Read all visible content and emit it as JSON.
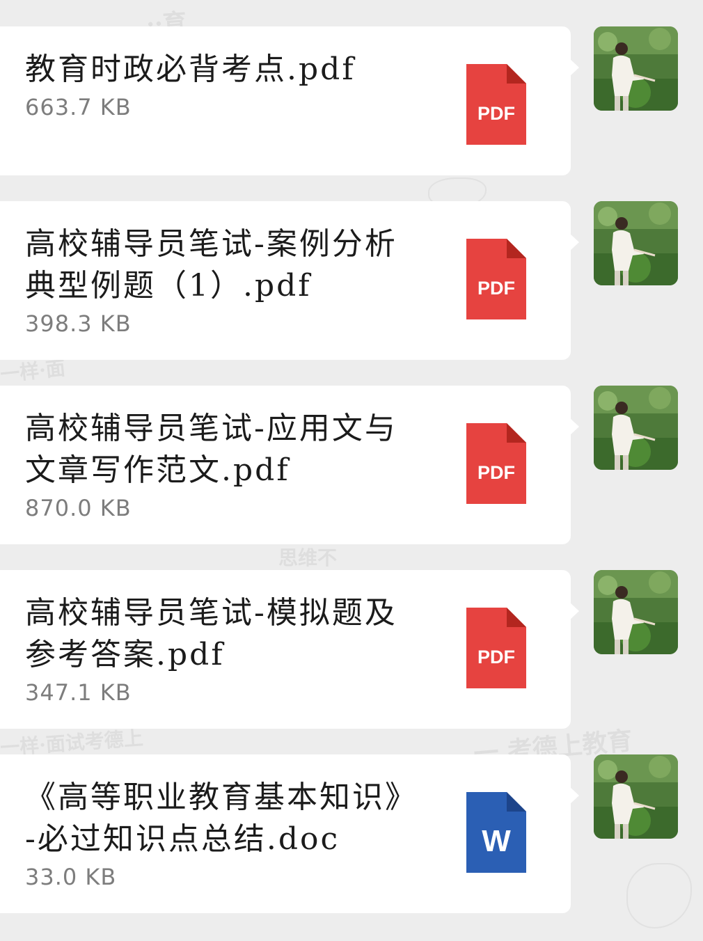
{
  "messages": [
    {
      "file_name": "教育时政必背考点.pdf",
      "file_size": "663.7 KB",
      "file_type": "pdf",
      "icon_label": "PDF",
      "icon_name": "pdf-file-icon",
      "icon_color": "#e64340"
    },
    {
      "file_name": "高校辅导员笔试-案例分析典型例题（1）.pdf",
      "file_size": "398.3 KB",
      "file_type": "pdf",
      "icon_label": "PDF",
      "icon_name": "pdf-file-icon",
      "icon_color": "#e64340"
    },
    {
      "file_name": "高校辅导员笔试-应用文与文章写作范文.pdf",
      "file_size": "870.0 KB",
      "file_type": "pdf",
      "icon_label": "PDF",
      "icon_name": "pdf-file-icon",
      "icon_color": "#e64340"
    },
    {
      "file_name": "高校辅导员笔试-模拟题及参考答案.pdf",
      "file_size": "347.1 KB",
      "file_type": "pdf",
      "icon_label": "PDF",
      "icon_name": "pdf-file-icon",
      "icon_color": "#e64340"
    },
    {
      "file_name": "《高等职业教育基本知识》-必过知识点总结.doc",
      "file_size": "33.0 KB",
      "file_type": "doc",
      "icon_label": "W",
      "icon_name": "word-file-icon",
      "icon_color": "#2b5fb4"
    }
  ],
  "avatar": {
    "icon_name": "user-avatar-photo"
  },
  "colors": {
    "background": "#ededed",
    "bubble": "#ffffff",
    "file_name_text": "#1b1b1b",
    "file_size_text": "#7d7d7d"
  }
}
